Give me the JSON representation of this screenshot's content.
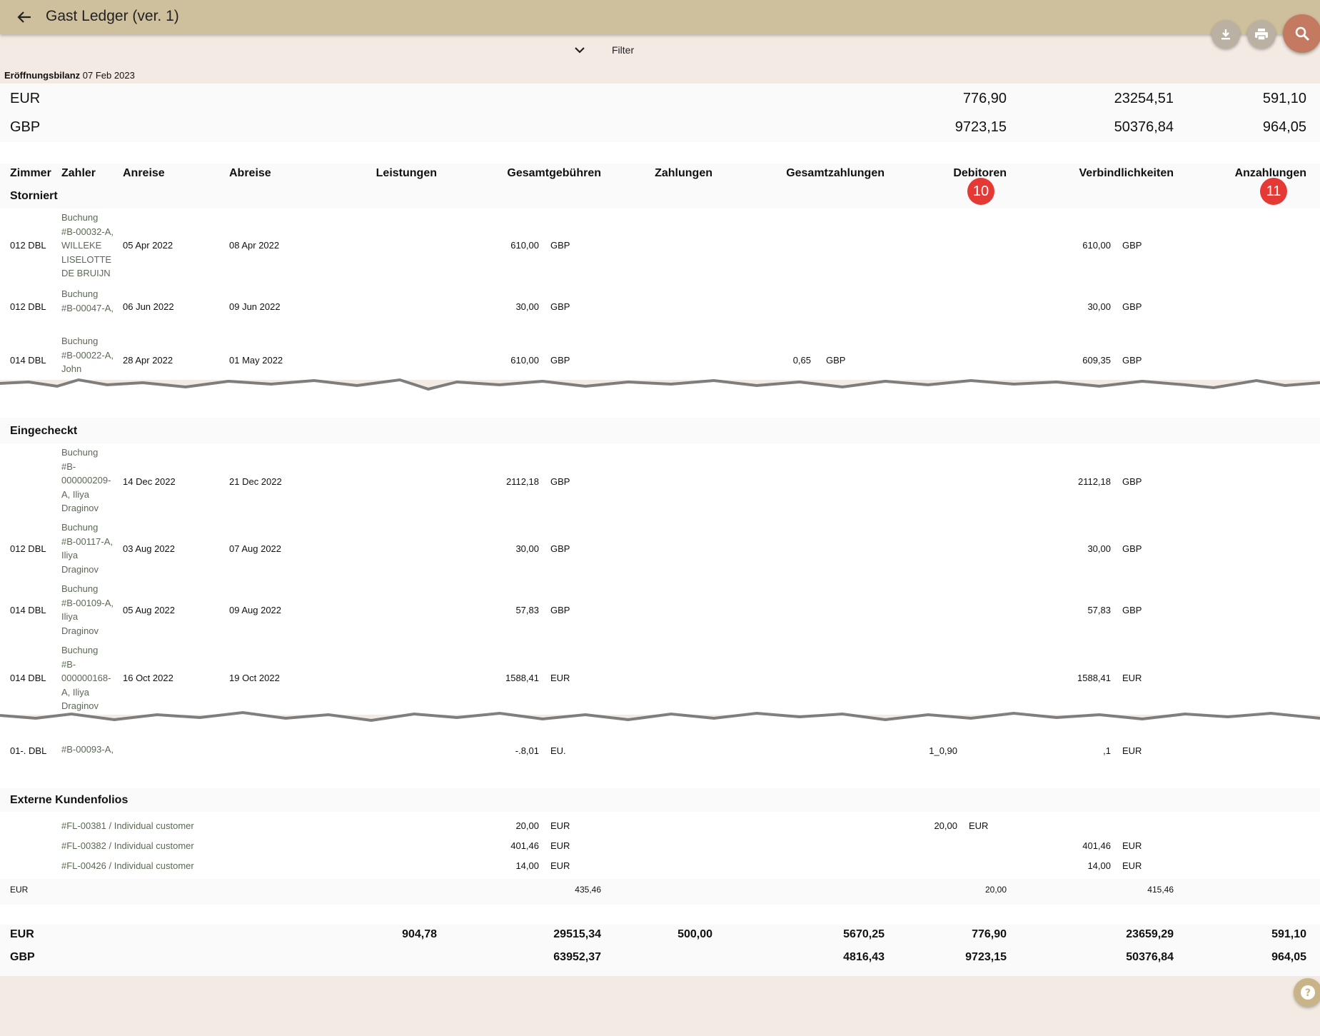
{
  "header": {
    "title": "Gast Ledger (ver. 1)"
  },
  "filter": {
    "label": "Filter"
  },
  "opening": {
    "label": "Eröffnungsbilanz",
    "date": "07 Feb 2023"
  },
  "opening_rows": [
    {
      "cur": "EUR",
      "debitoren": "776,90",
      "verbindlichkeiten": "23254,51",
      "anzahlungen": "591,10"
    },
    {
      "cur": "GBP",
      "debitoren": "9723,15",
      "verbindlichkeiten": "50376,84",
      "anzahlungen": "964,05"
    }
  ],
  "columns": {
    "zimmer": "Zimmer",
    "zahler": "Zahler",
    "anreise": "Anreise",
    "abreise": "Abreise",
    "leistungen": "Leistungen",
    "gesamtgebuehren": "Gesamtgebühren",
    "zahlungen": "Zahlungen",
    "gesamtzahlungen": "Gesamtzahlungen",
    "debitoren": "Debitoren",
    "verbindlichkeiten": "Verbindlichkeiten",
    "anzahlungen": "Anzahlungen"
  },
  "badges": {
    "debitoren": "10",
    "anzahlungen": "11"
  },
  "sections": {
    "storniert": "Storniert",
    "eingecheckt": "Eingecheckt",
    "extern": "Externe Kundenfolios"
  },
  "storniert_rows": [
    {
      "zimmer": "012 DBL",
      "payer": "Buchung #B-00032-A, WILLEKE LISELOTTE DE BRUIJN",
      "anreise": "05 Apr 2022",
      "abreise": "08 Apr 2022",
      "gebuehren": "610,00",
      "gcur": "GBP",
      "gesamtzahl": "",
      "zcur": "",
      "verb": "610,00",
      "vcur": "GBP"
    },
    {
      "zimmer": "012 DBL",
      "payer": "Buchung #B-00047-A,",
      "anreise": "06 Jun 2022",
      "abreise": "09 Jun 2022",
      "gebuehren": "30,00",
      "gcur": "GBP",
      "gesamtzahl": "",
      "zcur": "",
      "verb": "30,00",
      "vcur": "GBP"
    },
    {
      "zimmer": "014 DBL",
      "payer": "Buchung #B-00022-A, John",
      "anreise": "28 Apr 2022",
      "abreise": "01 May 2022",
      "gebuehren": "610,00",
      "gcur": "GBP",
      "gesamtzahl": "0,65",
      "zcur": "GBP",
      "verb": "609,35",
      "vcur": "GBP"
    }
  ],
  "eingecheckt_rows": [
    {
      "zimmer": "",
      "payer": "Buchung #B-000000209-A, Iliya Draginov",
      "anreise": "14 Dec 2022",
      "abreise": "21 Dec 2022",
      "gebuehren": "2112,18",
      "gcur": "GBP",
      "verb": "2112,18",
      "vcur": "GBP"
    },
    {
      "zimmer": "012 DBL",
      "payer": "Buchung #B-00117-A, Iliya Draginov",
      "anreise": "03 Aug 2022",
      "abreise": "07 Aug 2022",
      "gebuehren": "30,00",
      "gcur": "GBP",
      "verb": "30,00",
      "vcur": "GBP"
    },
    {
      "zimmer": "014 DBL",
      "payer": "Buchung #B-00109-A, Iliya Draginov",
      "anreise": "05 Aug 2022",
      "abreise": "09 Aug 2022",
      "gebuehren": "57,83",
      "gcur": "GBP",
      "verb": "57,83",
      "vcur": "GBP"
    },
    {
      "zimmer": "014 DBL",
      "payer": "Buchung #B-000000168-A, Iliya Draginov",
      "anreise": "16 Oct 2022",
      "abreise": "19 Oct 2022",
      "gebuehren": "1588,41",
      "gcur": "EUR",
      "verb": "1588,41",
      "vcur": "EUR"
    }
  ],
  "partial_row": {
    "zimmer": "01-. DBL",
    "payer": "#B-00093-A,",
    "gebuehren": "-.8,01",
    "gcur": "EU.",
    "deb": "1_0,90",
    "verb": ",1",
    "vcur": "EUR"
  },
  "extern_rows": [
    {
      "payer": "#FL-00381 / Individual customer",
      "gebuehren": "20,00",
      "gcur": "EUR",
      "deb": "20,00",
      "dcur": "EUR",
      "verb": "",
      "vcur": ""
    },
    {
      "payer": "#FL-00382 / Individual customer",
      "gebuehren": "401,46",
      "gcur": "EUR",
      "deb": "",
      "dcur": "",
      "verb": "401,46",
      "vcur": "EUR"
    },
    {
      "payer": "#FL-00426 / Individual customer",
      "gebuehren": "14,00",
      "gcur": "EUR",
      "deb": "",
      "dcur": "",
      "verb": "14,00",
      "vcur": "EUR"
    }
  ],
  "extern_total": {
    "cur": "EUR",
    "gebuehren": "435,46",
    "deb": "20,00",
    "verb": "415,46"
  },
  "totals": [
    {
      "cur": "EUR",
      "leistungen": "904,78",
      "gebuehren": "29515,34",
      "zahlungen": "500,00",
      "gesamtzahl": "5670,25",
      "deb": "776,90",
      "verb": "23659,29",
      "anz": "591,10"
    },
    {
      "cur": "GBP",
      "leistungen": "",
      "gebuehren": "63952,37",
      "zahlungen": "",
      "gesamtzahl": "4816,43",
      "deb": "9723,15",
      "verb": "50376,84",
      "anz": "964,05"
    }
  ]
}
